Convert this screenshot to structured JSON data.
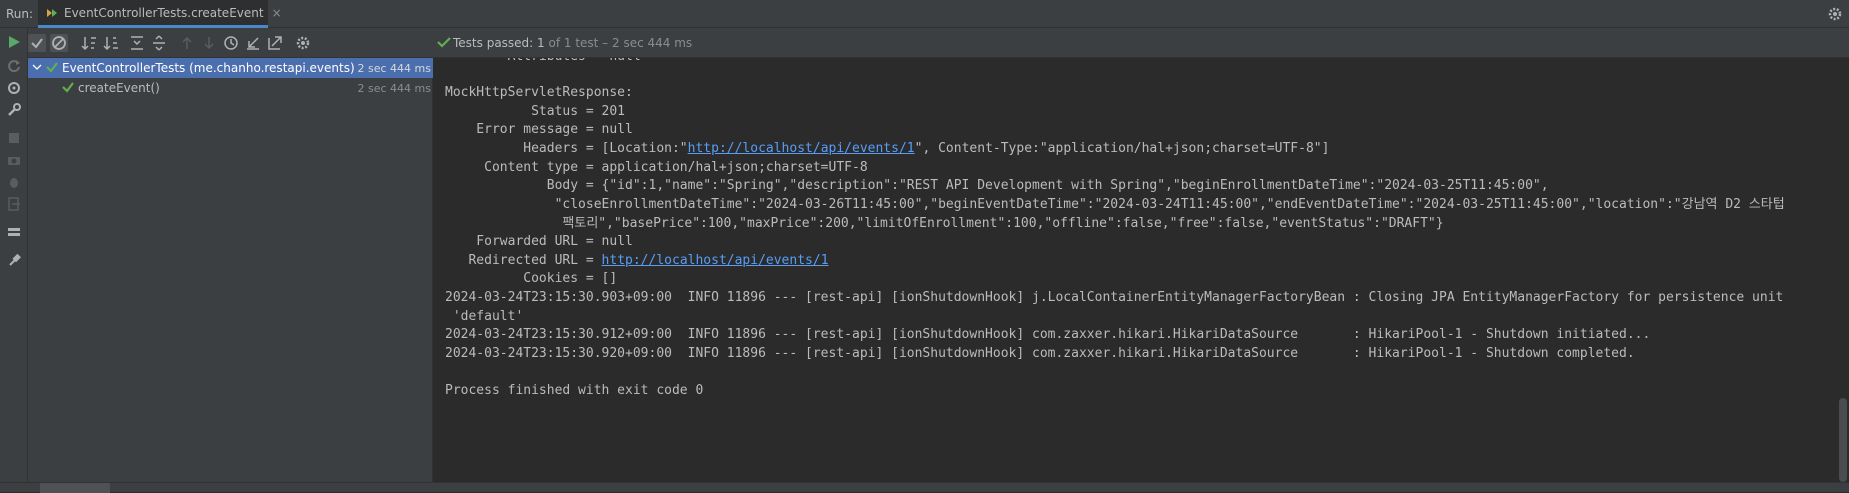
{
  "topbar": {
    "run_label": "Run:",
    "tab_label": "EventControllerTests.createEvent",
    "tab_close": "×",
    "settings_icon": "gear-icon"
  },
  "left_toolbar": {
    "icons": [
      "run-icon",
      "rerun-icon",
      "debug-icon",
      "wrench-icon",
      "stop-icon",
      "camera-icon",
      "bug-icon",
      "exit-icon",
      "layout-icon",
      "pin-icon"
    ]
  },
  "tree_toolbar": {
    "icons": [
      "show-passed-icon",
      "show-ignored-icon",
      "sort-alpha-icon",
      "sort-duration-icon",
      "expand-all-icon",
      "collapse-all-icon",
      "prev-failed-icon",
      "next-failed-icon",
      "history-icon",
      "import-icon",
      "export-icon",
      "settings-icon"
    ]
  },
  "tree": {
    "items": [
      {
        "label": "EventControllerTests (me.chanho.restapi.events)",
        "time": "2 sec 444 ms",
        "selected": true
      },
      {
        "label": "createEvent()",
        "time": "2 sec 444 ms",
        "selected": false
      }
    ]
  },
  "console_header": {
    "status_prefix": "Tests passed: ",
    "passed": "1",
    "status_suffix": " of 1 test – 2 sec 444 ms"
  },
  "console": {
    "lines": [
      "        Attributes = null",
      "",
      "MockHttpServletResponse:",
      "           Status = 201",
      "    Error message = null",
      "          Headers = [Location:\"",
      "     Content type = application/hal+json;charset=UTF-8",
      "             Body = {\"id\":1,\"name\":\"Spring\",\"description\":\"REST API Development with Spring\",\"beginEnrollmentDateTime\":\"2024-03-25T11:45:00\",",
      "              \"closeEnrollmentDateTime\":\"2024-03-26T11:45:00\",\"beginEventDateTime\":\"2024-03-24T11:45:00\",\"endEventDateTime\":\"2024-03-25T11:45:00\",\"location\":\"강남역 D2 스타텁",
      "               팩토리\",\"basePrice\":100,\"maxPrice\":200,\"limitOfEnrollment\":100,\"offline\":false,\"free\":false,\"eventStatus\":\"DRAFT\"}",
      "    Forwarded URL = null",
      "   Redirected URL = ",
      "          Cookies = []",
      "2024-03-24T23:15:30.903+09:00  INFO 11896 --- [rest-api] [ionShutdownHook] j.LocalContainerEntityManagerFactoryBean : Closing JPA EntityManagerFactory for persistence unit",
      " 'default'",
      "2024-03-24T23:15:30.912+09:00  INFO 11896 --- [rest-api] [ionShutdownHook] com.zaxxer.hikari.HikariDataSource       : HikariPool-1 - Shutdown initiated...",
      "2024-03-24T23:15:30.920+09:00  INFO 11896 --- [rest-api] [ionShutdownHook] com.zaxxer.hikari.HikariDataSource       : HikariPool-1 - Shutdown completed.",
      "",
      "Process finished with exit code 0"
    ],
    "headers_link": "http://localhost/api/events/1",
    "headers_tail": "\", Content-Type:\"application/hal+json;charset=UTF-8\"]",
    "redirect_link": "http://localhost/api/events/1"
  },
  "colors": {
    "accent": "#4b6eaf",
    "pass_green": "#5fb04f",
    "link": "#589df6"
  }
}
